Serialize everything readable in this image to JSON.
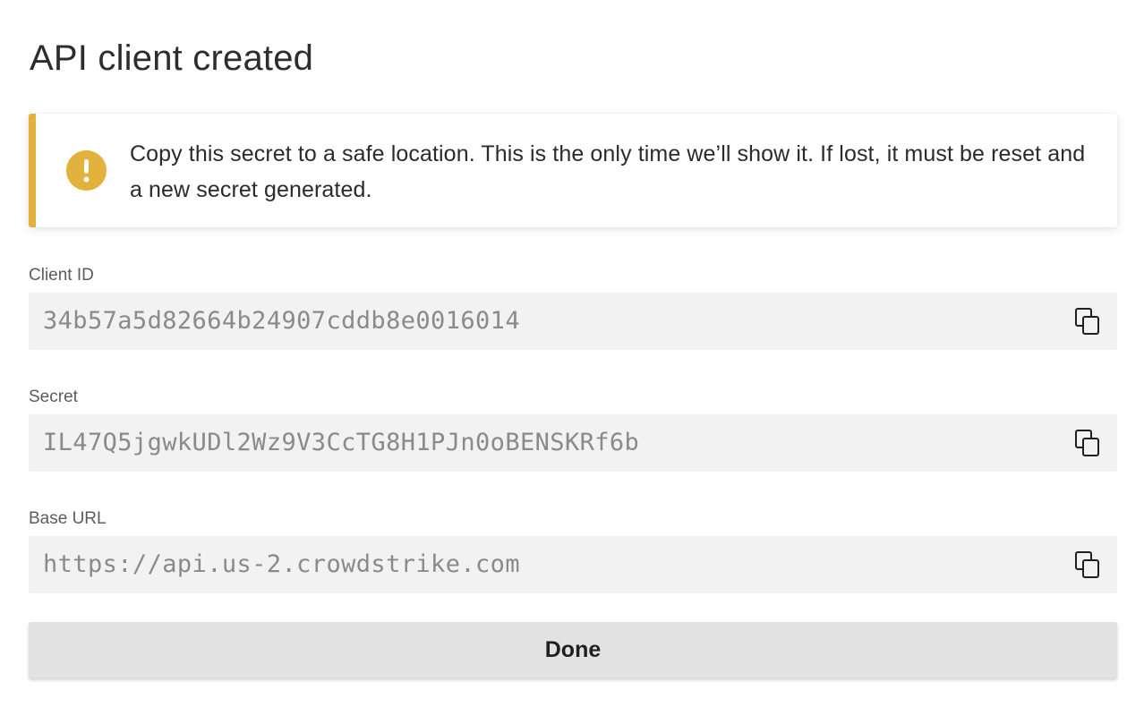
{
  "dialog": {
    "title": "API client created"
  },
  "alert": {
    "icon": "exclamation-icon",
    "color": "#e3b23c",
    "message": "Copy this secret to a safe location. This is the only time we’ll show it. If lost, it must be reset and a new secret generated."
  },
  "fields": {
    "client_id": {
      "label": "Client ID",
      "value": "34b57a5d82664b24907cddb8e0016014",
      "copy_icon": "copy-icon"
    },
    "secret": {
      "label": "Secret",
      "value": "IL47Q5jgwkUDl2Wz9V3CcTG8H1PJn0oBENSKRf6b",
      "copy_icon": "copy-icon"
    },
    "base_url": {
      "label": "Base URL",
      "value": "https://api.us-2.crowdstrike.com",
      "copy_icon": "copy-icon"
    }
  },
  "actions": {
    "done_label": "Done"
  }
}
